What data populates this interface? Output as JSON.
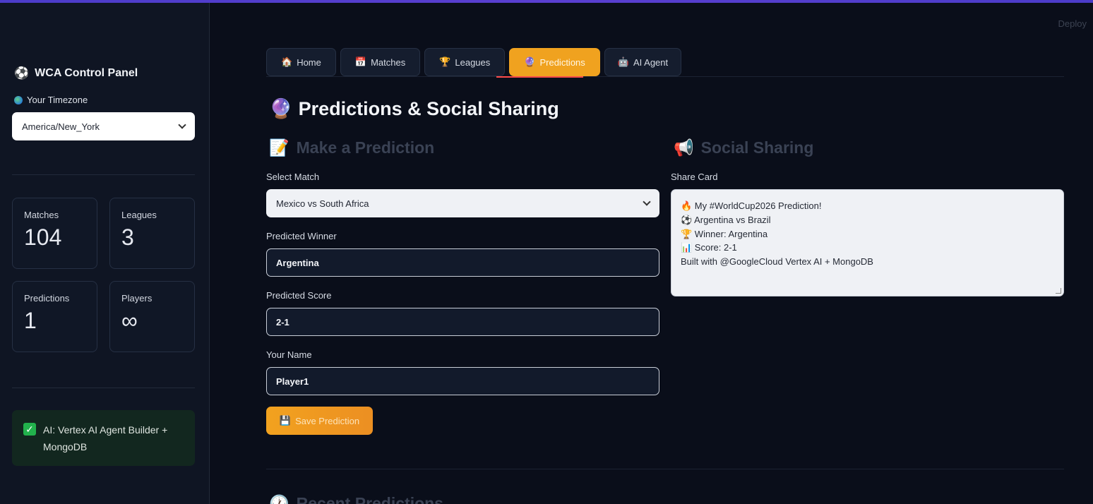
{
  "app": {
    "deploy_label": "Deploy"
  },
  "sidebar": {
    "title": "WCA Control Panel",
    "title_icon": "⚽",
    "timezone_label": "Your Timezone",
    "timezone_value": "America/New_York",
    "metrics": [
      {
        "label": "Matches",
        "value": "104"
      },
      {
        "label": "Leagues",
        "value": "3"
      },
      {
        "label": "Predictions",
        "value": "1"
      },
      {
        "label": "Players",
        "value": "∞"
      }
    ],
    "ai_status": "AI: Vertex AI Agent Builder + MongoDB"
  },
  "tabs": [
    {
      "icon": "🏠",
      "label": "Home"
    },
    {
      "icon": "📅",
      "label": "Matches"
    },
    {
      "icon": "🏆",
      "label": "Leagues"
    },
    {
      "icon": "🔮",
      "label": "Predictions",
      "active": true
    },
    {
      "icon": "🤖",
      "label": "AI Agent"
    }
  ],
  "page": {
    "title": "Predictions & Social Sharing",
    "title_icon": "🔮"
  },
  "prediction_form": {
    "heading": "Make a Prediction",
    "heading_icon": "📝",
    "select_match_label": "Select Match",
    "select_match_value": "Mexico vs South Africa",
    "winner_label": "Predicted Winner",
    "winner_value": "Argentina",
    "score_label": "Predicted Score",
    "score_value": "2-1",
    "name_label": "Your Name",
    "name_value": "Player1",
    "save_icon": "💾",
    "save_label": "Save Prediction"
  },
  "social": {
    "heading": "Social Sharing",
    "heading_icon": "📢",
    "share_card_label": "Share Card",
    "share_lines": [
      "🔥 My #WorldCup2026 Prediction!",
      "⚽ Argentina vs Brazil",
      "🏆 Winner: Argentina",
      "📊 Score: 2-1",
      "Built with @GoogleCloud Vertex AI + MongoDB"
    ]
  },
  "recent": {
    "heading": "Recent Predictions",
    "icon": "🕐"
  }
}
